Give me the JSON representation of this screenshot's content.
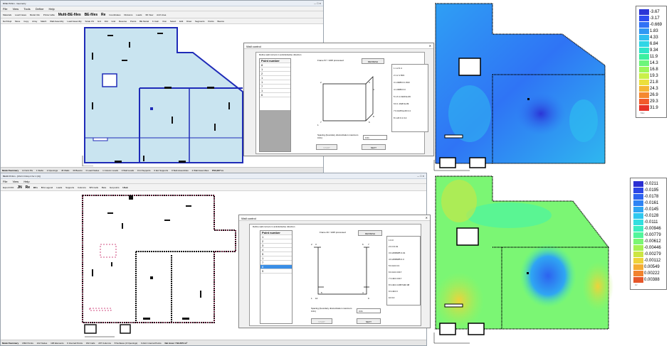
{
  "top": {
    "window_title": "RISE PLSim - Geometry",
    "menu": [
      "File",
      "View",
      "Tools",
      "Define",
      "Help"
    ],
    "tb1": [
      "Materials",
      "Load Cases",
      "Model Info",
      "Printer table",
      "Multi-BE-files",
      "BE-files",
      "Re",
      "Coordinates",
      "Divisions",
      "Loads",
      "3D View",
      "Arch Area"
    ],
    "tb2": [
      "Def Displ",
      "Move",
      "Copy",
      "Array",
      "Match",
      "Wall Assembly",
      "Load Assembly",
      "Scale CS",
      "Grd",
      "Fild",
      "Grid",
      "Reverse",
      "Points",
      "BE Model",
      "K Calc.",
      "Run",
      "Select",
      "Edit",
      "Draw",
      "Segments",
      "Points",
      "Beams"
    ],
    "status": [
      "Model Summary",
      "10 Grid Pts",
      "1 Slabs",
      "2 Openings",
      "45 Walls",
      "30 Beams",
      "0 Load Nodes",
      "1 Column Loads",
      "0 Wall Loads",
      "0 Int Supports",
      "0 Ext Supports",
      "0 Slab Assembles",
      "2 Wall Assembles",
      "PX3,Z37 Lv"
    ]
  },
  "dialog_top": {
    "title": "Wall control",
    "instruction": "Define wall corners in anticlockwise direction",
    "header": "Point number",
    "points": [
      "8",
      "1",
      "2",
      "1",
      "1",
      "7",
      "1",
      "6"
    ],
    "frame": "Frame 57 / 1325 processed",
    "refresh": "REFRESH",
    "coords": [
      "1  1.2 0.4",
      "2  1.2 1.503",
      "3  1.0086 6.1.503",
      "4  1.0086 6.0",
      "5  1.6 1.1920 E-09",
      "6  0.1 1920 E-09",
      "7  0.1025 E-06 0.4",
      "8  1.20 0.1 0.4"
    ],
    "nodes": [
      "2",
      "3",
      "6",
      "7",
      "1",
      "8",
      "4"
    ],
    "spacing_label": "Spacing (boundary discretization maximum 0.01)",
    "spacing_value": "0.01",
    "start": "START",
    "next": "NEXT"
  },
  "bottom": {
    "window_title": "BE4D PLSim - [Ch2 4 Crimp 4 for 1 (U)]",
    "menu": [
      "File",
      "View",
      "Help"
    ],
    "tb": [
      "Export DXF",
      "JN",
      "Re",
      "BCs",
      "BCs Legend",
      "Loads",
      "Supports",
      "Columns",
      "B/S Cells",
      "Beta",
      "Get points",
      "Uhek"
    ],
    "status": [
      "Model Summary",
      "1862 Points",
      "212 Nodes",
      "138 Elements",
      "6 Internal Points",
      "152 Cells",
      "207 Columns",
      "8 Surfaces (3 Openings)",
      "0 Add. Internal Points",
      "Net Area= 742.2974 m²"
    ]
  },
  "dialog_bottom": {
    "title": "Wall control",
    "instruction": "Define wall corners in anticlockwise direction",
    "header": "Point number",
    "points": [
      "1",
      "2",
      "3",
      "4",
      "5",
      "1",
      "7",
      "8",
      "9"
    ],
    "frame": "Frame 20 / 1325 processed",
    "refresh": "REFRESH",
    "coords": [
      "1  0.0",
      "2  0.3 0.01",
      "3  0.2095085 3.01",
      "4  0.2095085 0.3",
      "5  0.104 0.3",
      "6  0.104 3.017",
      "7  3.404 3.017",
      "8  3.404 3.2957446 08",
      "9  3.404 0",
      "10  0.0"
    ],
    "nodes": [
      "2",
      "3",
      "6",
      "7",
      "1",
      "10",
      "5",
      "4",
      "9"
    ],
    "spacing_label": "Spacing (boundary discretization maximum 0.01)",
    "spacing_value": "0.01",
    "start": "START",
    "next": "NEXT"
  },
  "legend_top": {
    "values": [
      "-3.67",
      "-3.17",
      "-0.669",
      "1.83",
      "4.33",
      "6.84",
      "9.34",
      "11.9",
      "14.3",
      "16.8",
      "19.3",
      "21.8",
      "24.3",
      "26.9",
      "29.3",
      "31.9"
    ],
    "colors": [
      "#2b35d6",
      "#2e4df0",
      "#2f71f5",
      "#2f98f4",
      "#2fbff0",
      "#2fd6e6",
      "#2fe6c9",
      "#3cf0a0",
      "#6cf57a",
      "#9df65a",
      "#c9f04a",
      "#ecdf3c",
      "#f5b535",
      "#f5882f",
      "#f25a2b",
      "#e73127"
    ],
    "footer": "Max"
  },
  "legend_bottom": {
    "values": [
      "-0.0211",
      "-0.0195",
      "-0.0178",
      "-0.0161",
      "-0.0145",
      "-0.0128",
      "-0.0111",
      "-0.00946",
      "-0.00779",
      "-0.00612",
      "-0.00446",
      "-0.00279",
      "-0.00112",
      "0.00549",
      "0.00222",
      "0.00388"
    ],
    "colors": [
      "#2b2fd2",
      "#2c46e6",
      "#2d63f0",
      "#2e83f4",
      "#2fa6f3",
      "#2fc8ef",
      "#33dfe0",
      "#3ceec1",
      "#52f59b",
      "#7bf674",
      "#a6f153",
      "#cde643",
      "#efd23a",
      "#f5ad33",
      "#f2822d",
      "#e6572a"
    ],
    "footer": "Uz"
  }
}
